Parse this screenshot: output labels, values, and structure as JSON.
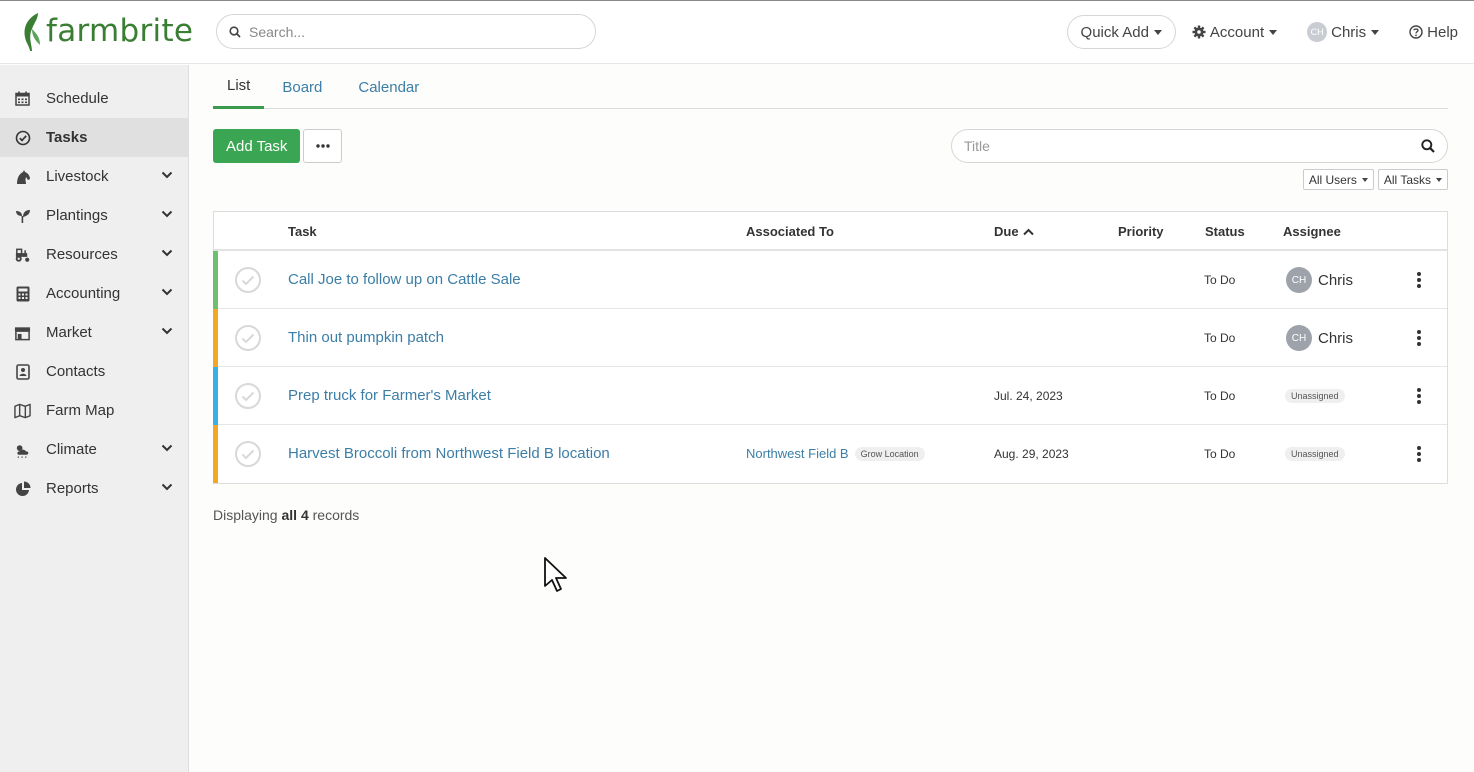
{
  "brand": {
    "name": "farmbrite",
    "color": "#3a7e33"
  },
  "header": {
    "search_placeholder": "Search...",
    "quick_add": "Quick Add",
    "account": "Account",
    "user_initials": "CH",
    "user_name": "Chris",
    "help": "Help"
  },
  "sidebar": {
    "items": [
      {
        "label": "Schedule",
        "icon": "calendar-icon",
        "expandable": false,
        "active": false
      },
      {
        "label": "Tasks",
        "icon": "check-circle-icon",
        "expandable": false,
        "active": true
      },
      {
        "label": "Livestock",
        "icon": "horse-icon",
        "expandable": true,
        "active": false
      },
      {
        "label": "Plantings",
        "icon": "seedling-icon",
        "expandable": true,
        "active": false
      },
      {
        "label": "Resources",
        "icon": "tractor-icon",
        "expandable": true,
        "active": false
      },
      {
        "label": "Accounting",
        "icon": "calculator-icon",
        "expandable": true,
        "active": false
      },
      {
        "label": "Market",
        "icon": "store-icon",
        "expandable": true,
        "active": false
      },
      {
        "label": "Contacts",
        "icon": "address-book-icon",
        "expandable": false,
        "active": false
      },
      {
        "label": "Farm Map",
        "icon": "map-icon",
        "expandable": false,
        "active": false
      },
      {
        "label": "Climate",
        "icon": "cloud-sun-icon",
        "expandable": true,
        "active": false
      },
      {
        "label": "Reports",
        "icon": "pie-chart-icon",
        "expandable": true,
        "active": false
      }
    ]
  },
  "main": {
    "tabs": [
      {
        "label": "List",
        "active": true
      },
      {
        "label": "Board",
        "active": false
      },
      {
        "label": "Calendar",
        "active": false
      }
    ],
    "add_task": "Add Task",
    "title_placeholder": "Title",
    "filters": {
      "users": "All Users",
      "tasks": "All Tasks"
    }
  },
  "table": {
    "columns": {
      "task": "Task",
      "associated": "Associated To",
      "due": "Due",
      "priority": "Priority",
      "status": "Status",
      "assignee": "Assignee"
    },
    "rows": [
      {
        "task": "Call Joe to follow up on Cattle Sale",
        "associated": "",
        "associated_tag": "",
        "due": "",
        "priority": "",
        "status": "To Do",
        "assignee_initials": "CH",
        "assignee": "Chris",
        "color": "#6cc070"
      },
      {
        "task": "Thin out pumpkin patch",
        "associated": "",
        "associated_tag": "",
        "due": "",
        "priority": "",
        "status": "To Do",
        "assignee_initials": "CH",
        "assignee": "Chris",
        "color": "#f5a623"
      },
      {
        "task": "Prep truck for Farmer's Market",
        "associated": "",
        "associated_tag": "",
        "due": "Jul. 24, 2023",
        "priority": "",
        "status": "To Do",
        "assignee_initials": "",
        "assignee": "Unassigned",
        "color": "#3ab0e8"
      },
      {
        "task": "Harvest Broccoli from Northwest Field B location",
        "associated": "Northwest Field B",
        "associated_tag": "Grow Location",
        "due": "Aug. 29, 2023",
        "priority": "",
        "status": "To Do",
        "assignee_initials": "",
        "assignee": "Unassigned",
        "color": "#f5a623"
      }
    ]
  },
  "footer": {
    "prefix": "Displaying",
    "bold": "all 4",
    "suffix": "records"
  },
  "colors": {
    "primary_green": "#3aa552",
    "link_blue": "#3c7ea6"
  }
}
